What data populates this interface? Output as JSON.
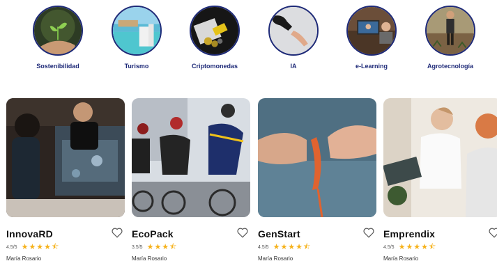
{
  "categories": [
    {
      "label": "Sostenibilidad",
      "icon": "plant-in-hand"
    },
    {
      "label": "Turismo",
      "icon": "beach-resort"
    },
    {
      "label": "Criptomonedas",
      "icon": "crypto-coins"
    },
    {
      "label": "IA",
      "icon": "robot-hand"
    },
    {
      "label": "e-Learning",
      "icon": "laptop-learning"
    },
    {
      "label": "Agrotecnología",
      "icon": "farmer-field"
    }
  ],
  "cards": [
    {
      "title": "InnovaRD",
      "rating": "4.5/5",
      "stars": 4.5,
      "author": "María Rosario"
    },
    {
      "title": "EcoPack",
      "rating": "3.5/5",
      "stars": 3.5,
      "author": "María Rosario"
    },
    {
      "title": "GenStart",
      "rating": "4.5/5",
      "stars": 4.5,
      "author": "María Rosario"
    },
    {
      "title": "Emprendix",
      "rating": "4.5/5",
      "stars": 4.5,
      "author": "María Rosario"
    }
  ],
  "colors": {
    "accent": "#1e2a78",
    "star": "#f6b21b"
  }
}
